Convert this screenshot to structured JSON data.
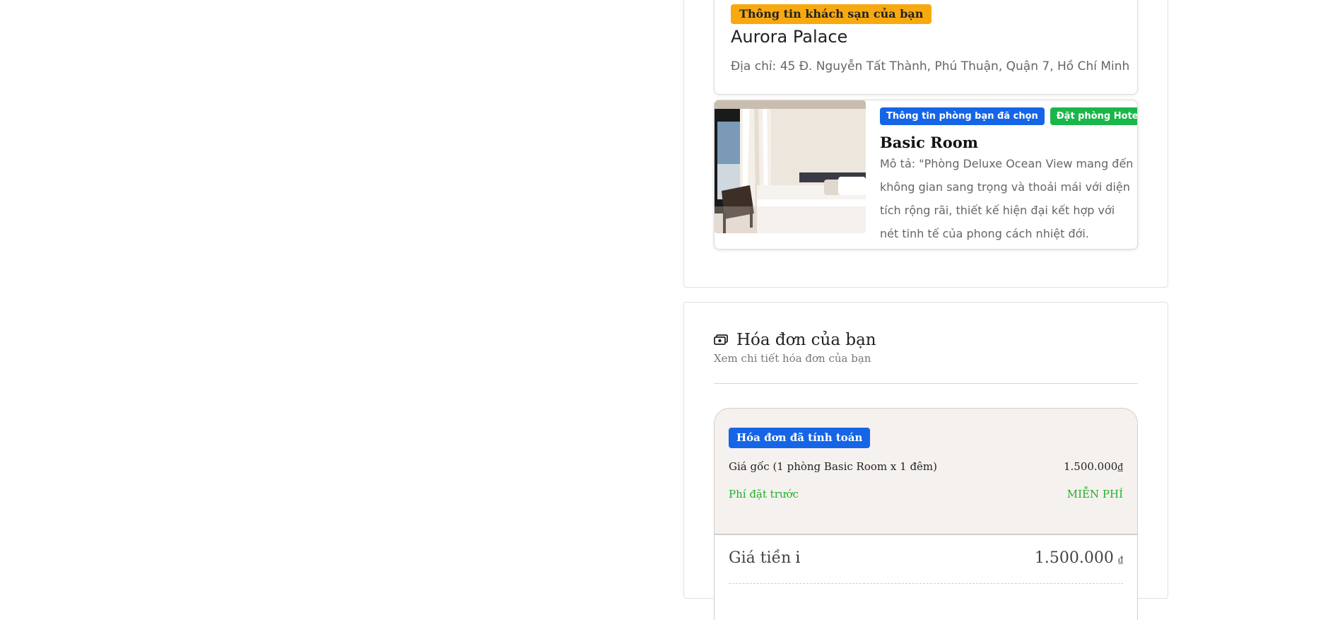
{
  "hotel": {
    "badge": "Thông tin khách sạn của bạn",
    "name": "Aurora Palace",
    "address": "Địa chỉ: 45 Đ. Nguyễn Tất Thành, Phú Thuận, Quận 7, Hồ Chí Minh"
  },
  "room": {
    "badge_selected": "Thông tin phòng bạn đã chọn",
    "badge_platform": "Đặt phòng Hotelas",
    "name": "Basic Room",
    "description": "Mô tả: \"Phòng Deluxe Ocean View mang đến không gian sang trọng và thoải mái với diện tích rộng rãi, thiết kế hiện đại kết hợp với nét tinh tế của phong cách nhiệt đới.",
    "photo_icon": "hotel-room-photo"
  },
  "invoice": {
    "icon": "bill-icon",
    "title": "Hóa đơn của bạn",
    "subtitle": "Xem chi tiết hóa đơn của bạn",
    "calc_badge": "Hóa đơn đã tính toán",
    "original_label": "Giá gốc (1 phòng Basic Room x 1 đêm)",
    "original_value": "1.500.000₫",
    "fee_label": "Phí đặt trước",
    "fee_value": "MIỄN PHÍ",
    "total_label": "Giá tiền",
    "total_info_icon": "info-icon",
    "total_value": "1.500.000",
    "total_currency": "₫"
  },
  "colors": {
    "badge_yellow": "#f7a90f",
    "badge_blue": "#1565e6",
    "badge_green": "#19b64a",
    "free_green": "#21b02b",
    "invoice_bg": "#f5f1ee"
  }
}
